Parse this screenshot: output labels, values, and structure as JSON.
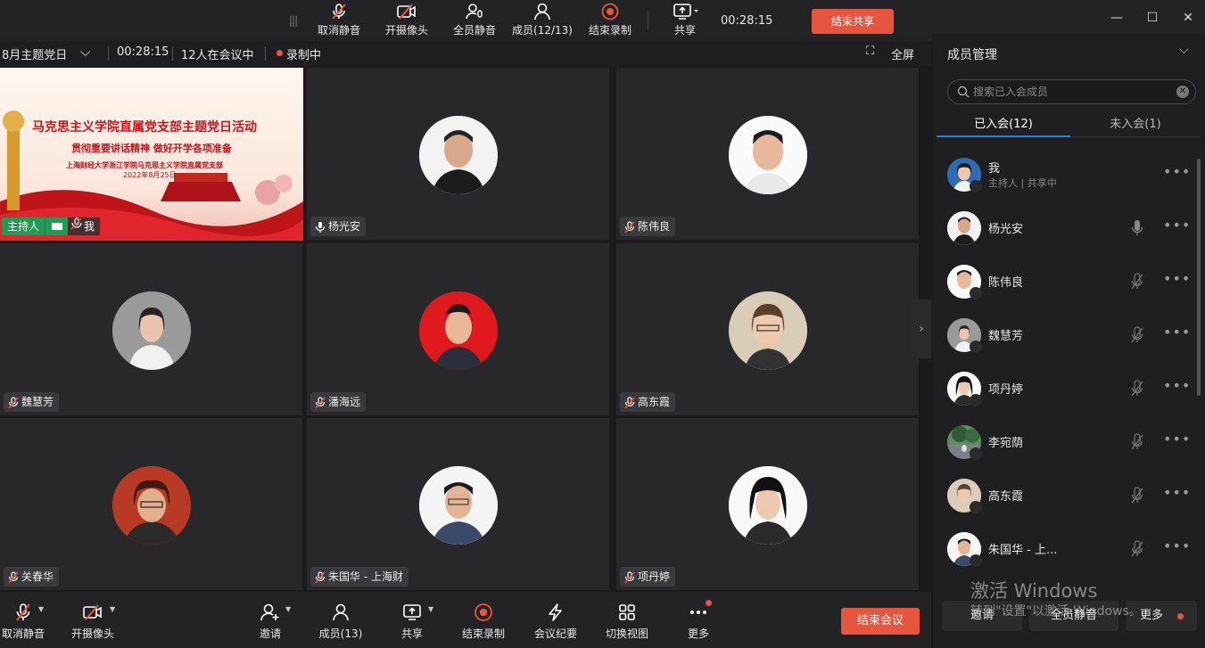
{
  "toolbar": {
    "unmute": "取消静音",
    "start_video": "开摄像头",
    "mute_all": "全员静音",
    "members": "成员(12/13)",
    "stop_record": "结束录制",
    "share": "共享",
    "timer": "00:28:15",
    "stop_share": "结束共享"
  },
  "infobar": {
    "meeting_title": "8月主题党日",
    "duration": "00:28:15",
    "participants": "12人在会议中",
    "recording": "录制中",
    "fullscreen": "全屏"
  },
  "share_slide": {
    "title": "马克思主义学院直属党支部主题党日活动",
    "subtitle": "贯彻重要讲话精神  做好开学各项准备",
    "org": "上海财经大学浙江学院马克思主义学院直属党支部",
    "date": "2022年8月25日",
    "host_role": "主持人",
    "self_name": "我"
  },
  "tiles": [
    {
      "name": "杨光安"
    },
    {
      "name": "陈伟良"
    },
    {
      "name": "魏慧芳"
    },
    {
      "name": "潘海远"
    },
    {
      "name": "高东霞"
    },
    {
      "name": "关春华"
    },
    {
      "name": "朱国华 - 上海财"
    },
    {
      "name": "项丹婷"
    }
  ],
  "bottombar": {
    "unmute": "取消静音",
    "start_video": "开摄像头",
    "invite": "邀请",
    "members": "成员(13)",
    "share": "共享",
    "stop_record": "结束录制",
    "minutes": "会议纪要",
    "switch_view": "切换视图",
    "more": "更多",
    "end_meeting": "结束会议"
  },
  "panel": {
    "title": "成员管理",
    "search_placeholder": "搜索已入会成员",
    "tab_joined": "已入会(12)",
    "tab_not_joined": "未入会(1)",
    "members": [
      {
        "name": "我",
        "sub": "主持人 | 共享中"
      },
      {
        "name": "杨光安"
      },
      {
        "name": "陈伟良"
      },
      {
        "name": "魏慧芳"
      },
      {
        "name": "项丹婷"
      },
      {
        "name": "李宛荫"
      },
      {
        "name": "高东霞"
      },
      {
        "name": "朱国华 - 上..."
      }
    ],
    "footer": {
      "invite": "邀请",
      "mute_all": "全员静音",
      "more": "更多"
    }
  },
  "watermark": {
    "line1": "激活 Windows",
    "line2": "转到\"设置\"以激活 Windows。"
  }
}
